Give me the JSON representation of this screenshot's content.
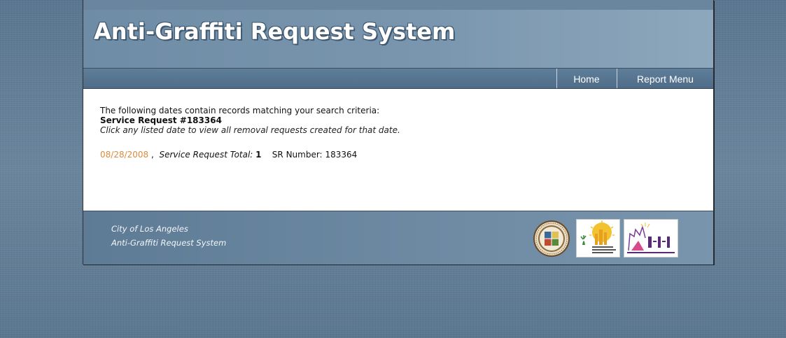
{
  "header": {
    "title": "Anti-Graffiti Request System"
  },
  "nav": {
    "items": [
      {
        "label": "Home"
      },
      {
        "label": "Report Menu"
      }
    ]
  },
  "main": {
    "intro": "The following dates contain records matching your search criteria:",
    "service_request_heading": "Service Request #183364",
    "instruction": "Click any listed date to view all removal requests created for that date.",
    "results": [
      {
        "date": "08/28/2008",
        "separator": " ,",
        "total_label": "Service Request Total:",
        "total_value": "1",
        "sr_label": "SR Number:",
        "sr_value": "183364"
      }
    ]
  },
  "footer": {
    "line1": "City of Los Angeles",
    "line2": "Anti-Graffiti Request System",
    "logos": [
      "city-seal-logo",
      "office-community-beautification-logo",
      "la-311-logo"
    ]
  },
  "colors": {
    "page_bg": "#5f7b94",
    "banner": "#7a96ae",
    "navbar": "#577590",
    "date_link": "#d98b3e",
    "footer": "#6e8aa3"
  }
}
